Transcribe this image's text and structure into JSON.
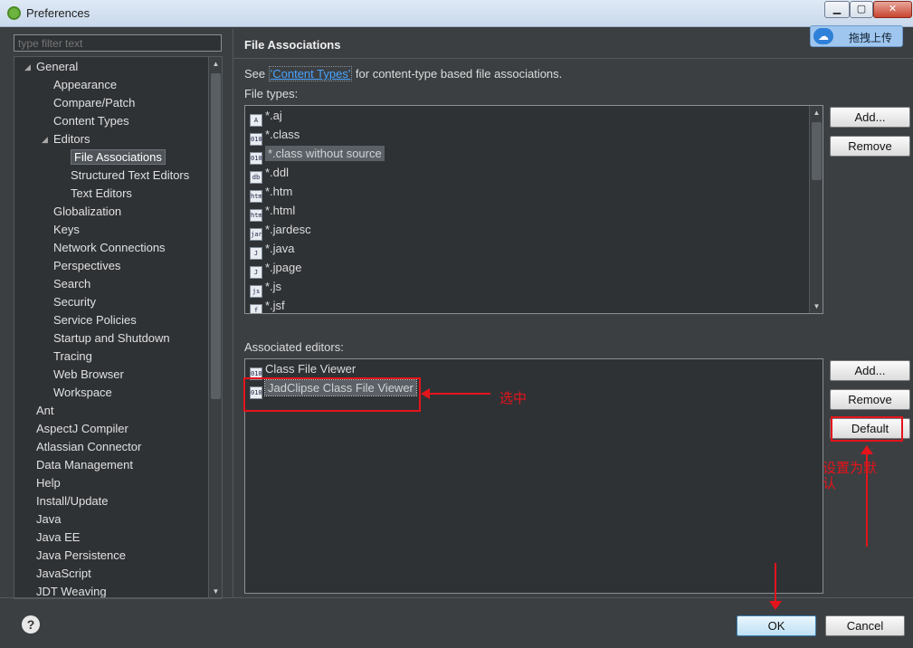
{
  "window": {
    "title": "Preferences",
    "min": "▁",
    "max": "▢",
    "close": "✕"
  },
  "badge": {
    "label": "拖拽上传",
    "icon": "cloud-icon"
  },
  "filter": {
    "placeholder": "type filter text"
  },
  "tree": {
    "items": [
      {
        "label": "General",
        "twisty": "◢"
      },
      {
        "label": "Appearance"
      },
      {
        "label": "Compare/Patch"
      },
      {
        "label": "Content Types"
      },
      {
        "label": "Editors",
        "twisty": "◢"
      },
      {
        "label": "File Associations"
      },
      {
        "label": "Structured Text Editors"
      },
      {
        "label": "Text Editors"
      },
      {
        "label": "Globalization"
      },
      {
        "label": "Keys"
      },
      {
        "label": "Network Connections"
      },
      {
        "label": "Perspectives"
      },
      {
        "label": "Search"
      },
      {
        "label": "Security"
      },
      {
        "label": "Service Policies"
      },
      {
        "label": "Startup and Shutdown"
      },
      {
        "label": "Tracing"
      },
      {
        "label": "Web Browser"
      },
      {
        "label": "Workspace"
      },
      {
        "label": "Ant"
      },
      {
        "label": "AspectJ Compiler"
      },
      {
        "label": "Atlassian Connector"
      },
      {
        "label": "Data Management"
      },
      {
        "label": "Help"
      },
      {
        "label": "Install/Update"
      },
      {
        "label": "Java"
      },
      {
        "label": "Java EE"
      },
      {
        "label": "Java Persistence"
      },
      {
        "label": "JavaScript"
      },
      {
        "label": "JDT Weaving"
      }
    ]
  },
  "page": {
    "title": "File Associations",
    "see_prefix": "See ",
    "see_link": "'Content Types'",
    "see_suffix": " for content-type based file associations.",
    "file_types_label": "File types:",
    "associated_label": "Associated editors:"
  },
  "file_types": [
    {
      "label": "*.aj",
      "icon": "A"
    },
    {
      "label": "*.class",
      "icon": "010"
    },
    {
      "label": "*.class without source",
      "icon": "010"
    },
    {
      "label": "*.ddl",
      "icon": "db"
    },
    {
      "label": "*.htm",
      "icon": "htm"
    },
    {
      "label": "*.html",
      "icon": "htm"
    },
    {
      "label": "*.jardesc",
      "icon": "jar"
    },
    {
      "label": "*.java",
      "icon": "J"
    },
    {
      "label": "*.jpage",
      "icon": "J"
    },
    {
      "label": "*.js",
      "icon": "js"
    },
    {
      "label": "*.jsf",
      "icon": "f"
    }
  ],
  "editors": [
    {
      "label": "Class File Viewer",
      "icon": "010"
    },
    {
      "label": "JadClipse Class File Viewer",
      "icon": "010"
    }
  ],
  "buttons": {
    "add": "Add...",
    "remove": "Remove",
    "default": "Default",
    "ok": "OK",
    "cancel": "Cancel",
    "help": "?"
  },
  "annotations": {
    "select_note": "选中",
    "default_note_line1": "设置为默",
    "default_note_line2": "认"
  },
  "colors": {
    "annotation": "#e4141b",
    "link": "#4aa3ff"
  }
}
